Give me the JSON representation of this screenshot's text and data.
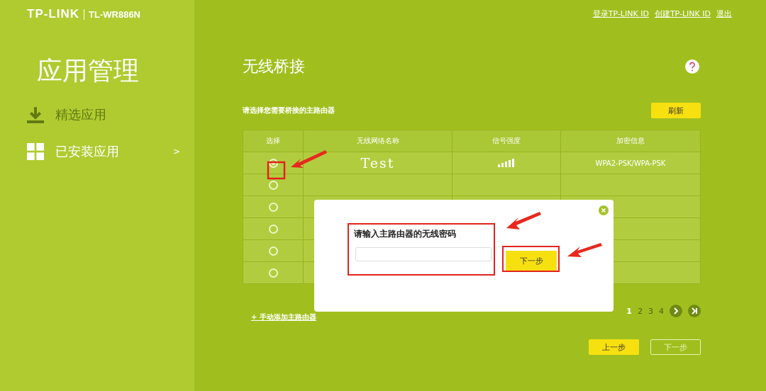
{
  "logo": {
    "brand": "TP-LINK",
    "model": "TL-WR886N"
  },
  "sidebar": {
    "title": "应用管理",
    "items": [
      {
        "label": "精选应用",
        "selected": false
      },
      {
        "label": "已安装应用",
        "selected": true,
        "arrow": ">"
      }
    ]
  },
  "header_links": [
    "登录TP-LINK ID",
    "创建TP-LINK ID",
    "退出"
  ],
  "page_title": "无线桥接",
  "instruction": "请选择您需要桥接的主路由器",
  "refresh_button": "刷新",
  "table": {
    "columns": [
      "选择",
      "无线网络名称",
      "信号强度",
      "加密信息"
    ],
    "rows": [
      {
        "kind": "network",
        "selected": true,
        "ssid": "Test",
        "security": "WPA2-PSK/WPA-PSK"
      },
      {
        "kind": "empty",
        "selected": false
      },
      {
        "kind": "empty",
        "selected": false
      },
      {
        "kind": "empty",
        "selected": false
      },
      {
        "kind": "empty",
        "selected": false
      },
      {
        "kind": "empty",
        "selected": false
      }
    ]
  },
  "add_link": "+ 手动添加主路由器",
  "pagination": {
    "pages": [
      {
        "label": "1",
        "selected": true
      },
      {
        "label": "2",
        "selected": false
      },
      {
        "label": "3",
        "selected": false
      },
      {
        "label": "4",
        "selected": false
      }
    ]
  },
  "footer_buttons": [
    {
      "label": "上一步",
      "kind": "primary"
    },
    {
      "label": "下一步",
      "kind": "outline"
    }
  ],
  "dialog": {
    "label": "请输入主路由器的无线密码",
    "button": "下一步"
  }
}
